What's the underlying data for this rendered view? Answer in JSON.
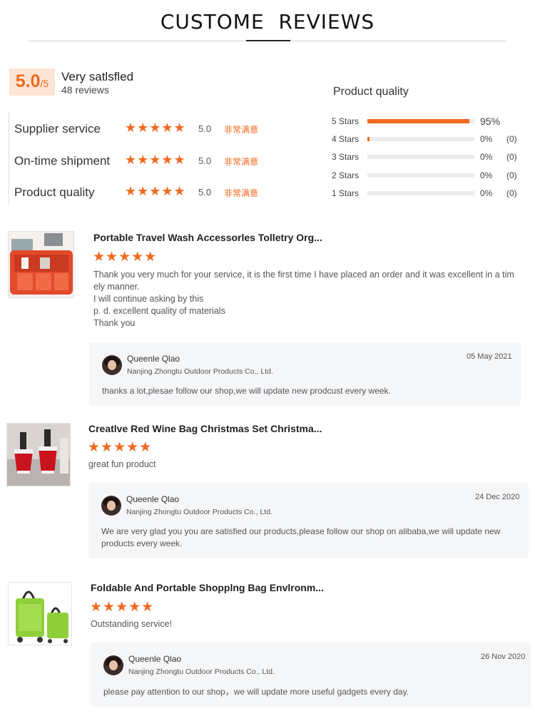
{
  "header": {
    "title": "CUSTOME  REVIEWS"
  },
  "summary": {
    "score": "5.0",
    "score_denominator": "/5",
    "satisfaction": "Very satlsfled",
    "review_count": "48 reviews"
  },
  "metrics": [
    {
      "label": "Supplier service",
      "stars": "★★★★★",
      "value": "5.0",
      "word": "非常满意"
    },
    {
      "label": "On-time shipment",
      "stars": "★★★★★",
      "value": "5.0",
      "word": "非常满意"
    },
    {
      "label": "Product quality",
      "stars": "★★★★★",
      "value": "5.0",
      "word": "非常满意"
    }
  ],
  "product_quality": {
    "title": "Product quality",
    "distribution": [
      {
        "label": "5 Stars",
        "fraction": 0.95,
        "percent": "95%",
        "count": ""
      },
      {
        "label": "4 Stars",
        "fraction": 0.02,
        "percent": "0%",
        "count": "(0)"
      },
      {
        "label": "3 Stars",
        "fraction": 0,
        "percent": "0%",
        "count": "(0)"
      },
      {
        "label": "2 Stars",
        "fraction": 0,
        "percent": "0%",
        "count": "(0)"
      },
      {
        "label": "1 Stars",
        "fraction": 0,
        "percent": "0%",
        "count": "(0)"
      }
    ]
  },
  "reviews": [
    {
      "product_title": "Portable Travel Wash Accessorles Tolletry Org...",
      "stars": "★★★★★",
      "text": "Thank you very much for your service, it is the first time I have placed an order and it was excellent in a tim\nely manner.\nI will continue asking by this\np. d. excellent quality of materials\nThank you",
      "reply": {
        "name": "Queenle Qlao",
        "company": "Nanjing Zhongtu Outdoor Products Co., Ltd.",
        "date": "05 May 2021",
        "text": "thanks a lot,plesae follow our shop,we will update new prodcust every week."
      }
    },
    {
      "product_title": "Creatlve Red Wine Bag Christmas Set Christma...",
      "stars": "★★★★★",
      "text": "great fun product",
      "reply": {
        "name": "Queenle Qlao",
        "company": "Nanjing Zhongtu Outdoor Products Co., Ltd.",
        "date": "24 Dec 2020",
        "text": "We are very glad you you are satisfied our products,please follow our shop on alibaba,we will update new\nproducts every week."
      }
    },
    {
      "product_title": "Foldable And Portable Shopplng Bag Envlronm...",
      "stars": "★★★★★",
      "text": "Outstanding service!",
      "reply": {
        "name": "Queenle Qlao",
        "company": "Nanjing Zhongtu Outdoor Products Co., Ltd.",
        "date": "26 Nov 2020",
        "text": "please pay attention to our shop，we will update more useful gadgets every day."
      }
    }
  ],
  "colors": {
    "accent": "#f06a1e",
    "badge_bg": "#fde4d4",
    "reply_bg": "#f5f6f8",
    "track": "#ececec"
  }
}
